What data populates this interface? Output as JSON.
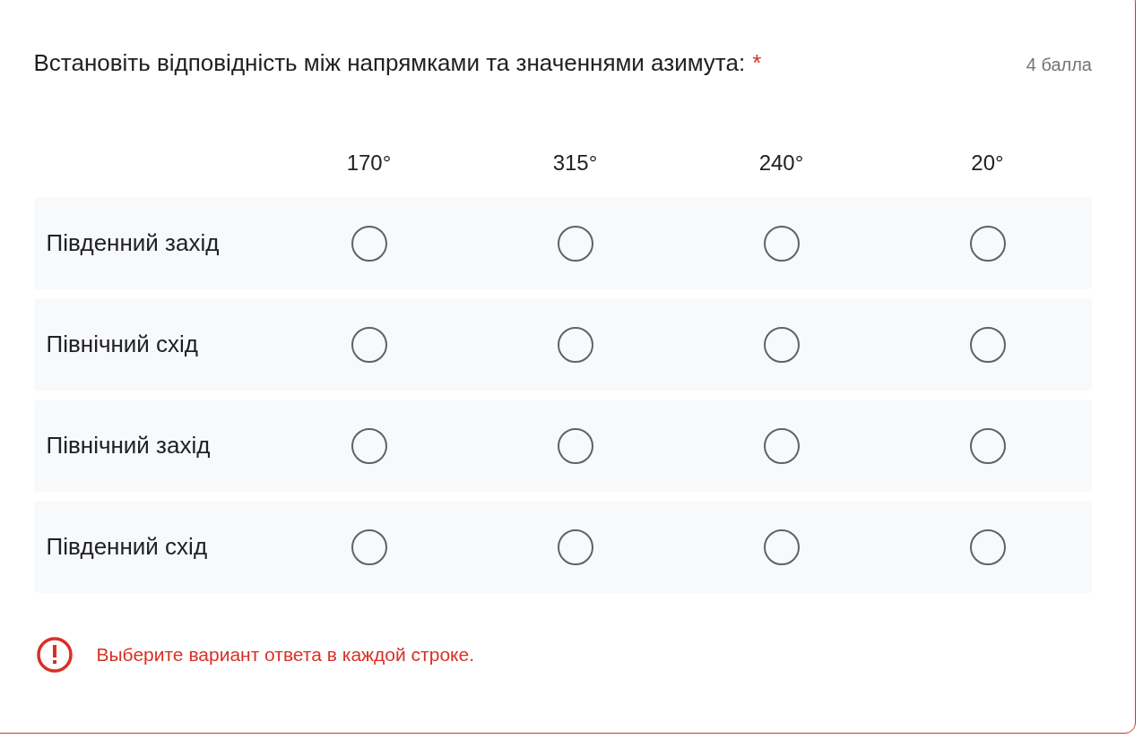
{
  "question": {
    "title": "Встановіть відповідність між напрямками та значеннями азимута:",
    "required_mark": "*",
    "points": "4 балла"
  },
  "columns": [
    "170°",
    "315°",
    "240°",
    "20°"
  ],
  "rows": [
    {
      "label": "Південний захід",
      "options": [
        {
          "selected": false
        },
        {
          "selected": false
        },
        {
          "selected": false
        },
        {
          "selected": false
        }
      ]
    },
    {
      "label": "Північний схід",
      "options": [
        {
          "selected": false
        },
        {
          "selected": false
        },
        {
          "selected": false
        },
        {
          "selected": false
        }
      ]
    },
    {
      "label": "Північний захід",
      "options": [
        {
          "selected": false
        },
        {
          "selected": false
        },
        {
          "selected": false
        },
        {
          "selected": false
        }
      ]
    },
    {
      "label": "Південний схід",
      "options": [
        {
          "selected": false
        },
        {
          "selected": false
        },
        {
          "selected": false
        },
        {
          "selected": false
        }
      ]
    }
  ],
  "error": {
    "message": "Выберите вариант ответа в каждой строке."
  }
}
